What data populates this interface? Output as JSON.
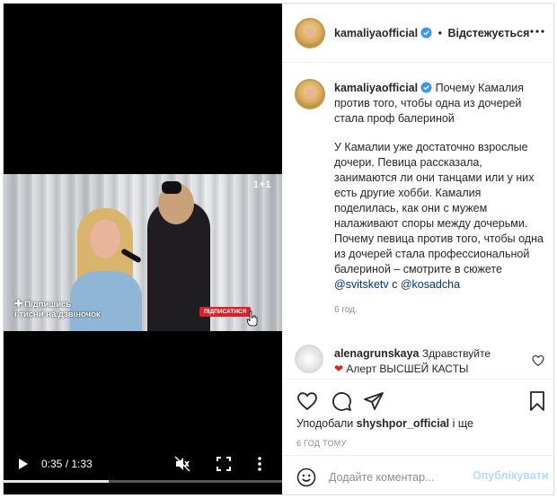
{
  "video": {
    "overlay_line1": "Підпишись",
    "overlay_line2": "і тисни на дзвіночок",
    "subscribe_pill": "ПІДПИСАТИСЯ",
    "channel_logo": "1+1",
    "time": "0:35 / 1:33",
    "progress": 0.376
  },
  "header": {
    "username": "kamaliyaofficial",
    "separator": "•",
    "follow_status": "Відстежується"
  },
  "caption": {
    "username": "kamaliyaofficial",
    "intro": "Почему Камалия против того, чтобы одна из дочерей стала проф балериной",
    "body": "У Камалии уже достаточно взрослые дочери. Певица рассказала, занимаются ли они танцами или у них есть другие хобби. Камалия поделилась, как они с мужем налаживают споры между дочерьми. Почему певица против того, чтобы одна из дочерей стала профессиональной балериной – смотрите в сюжете ",
    "link1": "@svitsketv",
    "joiner": " с ",
    "link2": "@kosadcha",
    "time": "6 год."
  },
  "comment": {
    "username": "alenagrunskaya",
    "text_line1": "Здравствуйте",
    "heart": "❤",
    "text_line2": "Алерт ВЫСШЕЙ КАСТЫ"
  },
  "actions": {
    "likes_prefix": "Уподобали ",
    "likes_user": "shyshpor_official",
    "likes_suffix": " і ще",
    "post_time": "6 ГОД ТОМУ"
  },
  "comment_bar": {
    "placeholder": "Додайте коментар...",
    "post_label": "Опублікувати"
  },
  "colors": {
    "accent_link": "#00376b",
    "verified": "#3897f0",
    "post_button_disabled": "#b3dbff"
  }
}
